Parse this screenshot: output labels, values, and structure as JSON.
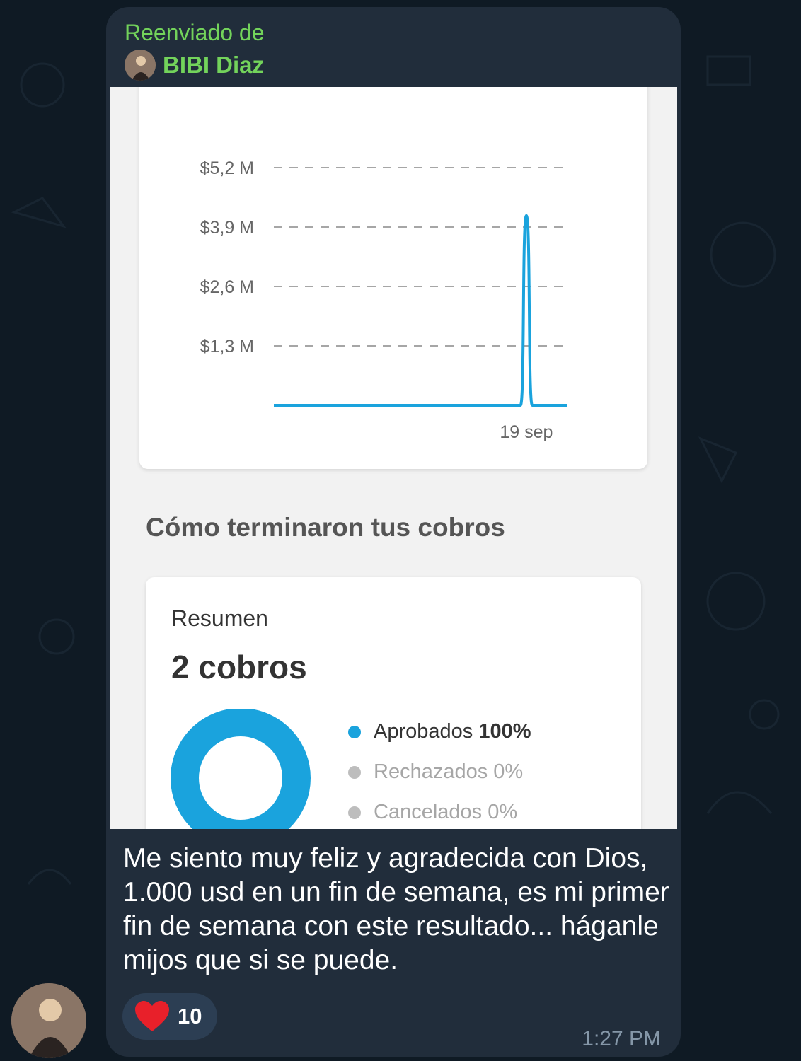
{
  "forward": {
    "label": "Reenviado de",
    "author": "BIBI Diaz"
  },
  "screenshot": {
    "chart_data": {
      "type": "line",
      "y_tick_labels": [
        "$5,2 M",
        "$3,9 M",
        "$2,6 M",
        "$1,3 M"
      ],
      "y_ticks": [
        5.2,
        3.9,
        2.6,
        1.3
      ],
      "ylim": [
        0,
        5.2
      ],
      "x_tick_labels": [
        "19 sep"
      ],
      "series": [
        {
          "color": "#1aa3dd",
          "x": [
            0,
            20,
            21,
            21.5,
            22,
            23,
            25
          ],
          "values": [
            0,
            0,
            0,
            4.15,
            0,
            0,
            0
          ]
        }
      ],
      "grid": "dashed-horizontal"
    },
    "section_title": "Cómo terminaron tus cobros",
    "summary": {
      "title": "Resumen",
      "count": "2 cobros",
      "legend": [
        {
          "label": "Aprobados",
          "value": "100%",
          "color": "#1aa3dd"
        },
        {
          "label": "Rechazados",
          "value": "0%",
          "color": "#bdbdbd"
        },
        {
          "label": "Cancelados",
          "value": "0%",
          "color": "#bdbdbd"
        }
      ],
      "donut_share": [
        1.0,
        0,
        0
      ]
    }
  },
  "message": {
    "text": "Me siento muy feliz y agradecida con Dios, 1.000 usd en un fin de semana, es mi primer fin de semana con este resultado... háganle mijos que si se puede.",
    "reaction_icon": "heart-icon",
    "reaction_count": "10",
    "time": "1:27 PM"
  },
  "colors": {
    "accent_green": "#73d35b",
    "bubble": "#212d3b",
    "chart_line": "#1aa3dd"
  }
}
